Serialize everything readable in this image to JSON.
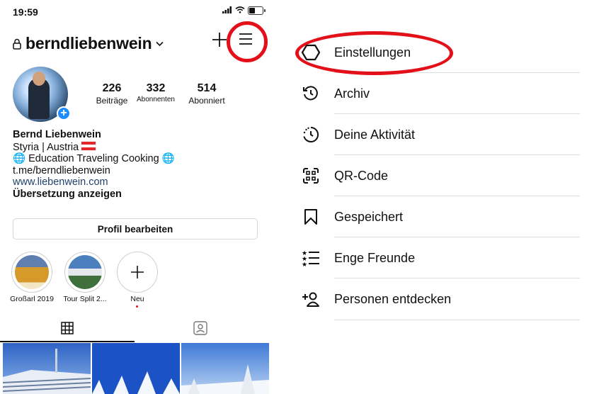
{
  "status_bar": {
    "time": "19:59"
  },
  "header": {
    "username": "berndliebenwein"
  },
  "stats": [
    {
      "count": "226",
      "label": "Beiträge"
    },
    {
      "count": "332",
      "label": "Abonnenten"
    },
    {
      "count": "514",
      "label": "Abonniert"
    }
  ],
  "bio": {
    "name": "Bernd Liebenwein",
    "location": "Styria | Austria",
    "interests": "Education Traveling Cooking",
    "telegram": "t.me/berndliebenwein",
    "website": "www.liebenwein.com",
    "translate": "Übersetzung anzeigen"
  },
  "edit_profile_label": "Profil bearbeiten",
  "highlights": [
    {
      "label": "Großarl 2019"
    },
    {
      "label": "Tour Split 2..."
    },
    {
      "label": "Neu"
    }
  ],
  "menu": {
    "items": [
      {
        "label": "Einstellungen",
        "icon": "settings-icon"
      },
      {
        "label": "Archiv",
        "icon": "archive-icon"
      },
      {
        "label": "Deine Aktivität",
        "icon": "activity-icon"
      },
      {
        "label": "QR-Code",
        "icon": "qr-code-icon"
      },
      {
        "label": "Gespeichert",
        "icon": "bookmark-icon"
      },
      {
        "label": "Enge Freunde",
        "icon": "close-friends-icon"
      },
      {
        "label": "Personen entdecken",
        "icon": "add-person-icon"
      }
    ]
  },
  "colors": {
    "annotation_red": "#e3101a",
    "link_blue": "#21416d",
    "badge_blue": "#1d8cff"
  }
}
